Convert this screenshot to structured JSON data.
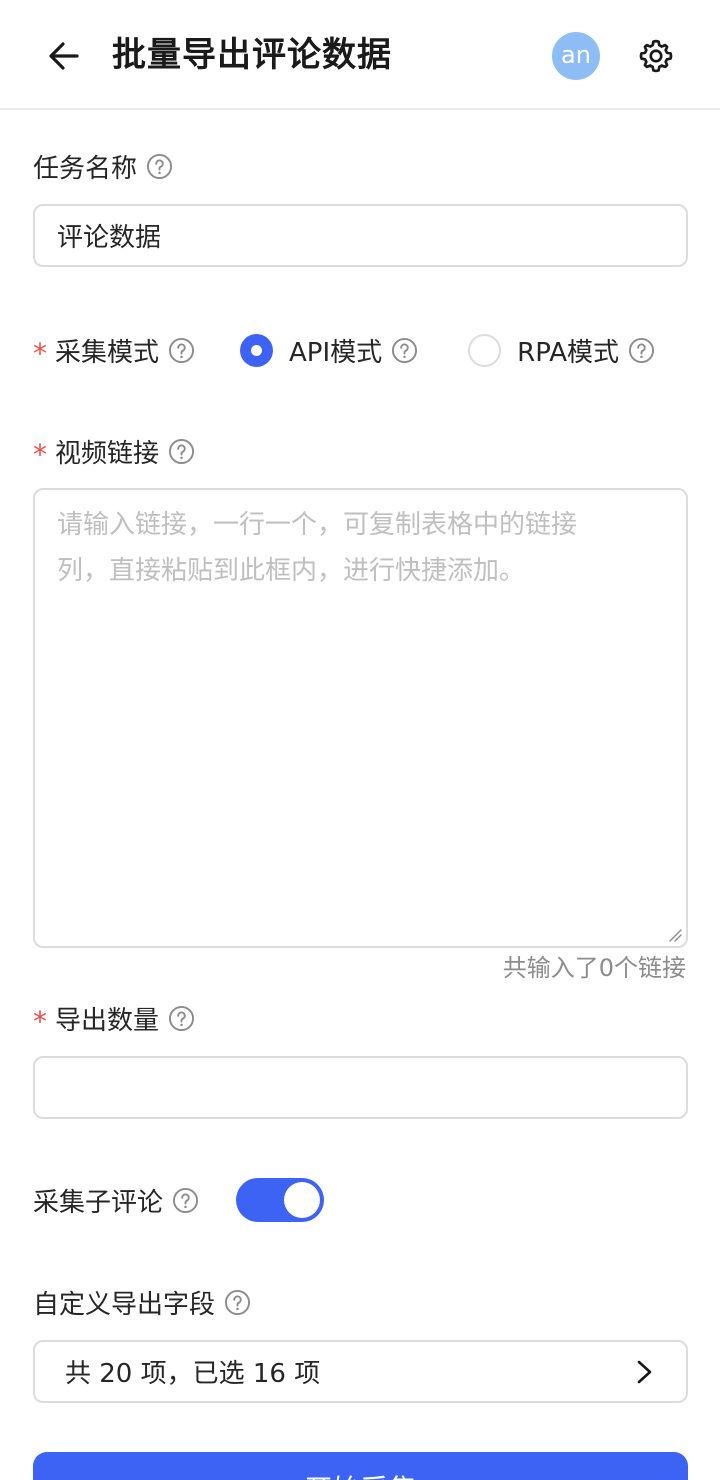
{
  "header": {
    "title": "批量导出评论数据",
    "avatar_text": "an"
  },
  "form": {
    "task_name": {
      "label": "任务名称",
      "value": "评论数据"
    },
    "collect_mode": {
      "label": "采集模式",
      "options": [
        {
          "label": "API模式",
          "selected": true
        },
        {
          "label": "RPA模式",
          "selected": false
        }
      ]
    },
    "video_links": {
      "label": "视频链接",
      "placeholder_line1": "请输入链接，一行一个，可复制表格中的链接",
      "placeholder_line2": "列，直接粘贴到此框内，进行快捷添加。",
      "count_text": "共输入了0个链接"
    },
    "export_count": {
      "label": "导出数量",
      "value": ""
    },
    "sub_comments": {
      "label": "采集子评论",
      "enabled": true
    },
    "custom_fields": {
      "label": "自定义导出字段",
      "summary": "共 20 项，已选 16 项"
    }
  },
  "submit": {
    "label": "开始采集"
  },
  "colors": {
    "primary": "#3d63f5",
    "required": "#f04d4d",
    "avatar": "#8ebdf5",
    "border": "#dcdcdc"
  },
  "icons": {
    "back": "arrow-left-icon",
    "settings": "gear-icon",
    "help": "question-circle-icon",
    "select": "chevron-right-icon"
  }
}
